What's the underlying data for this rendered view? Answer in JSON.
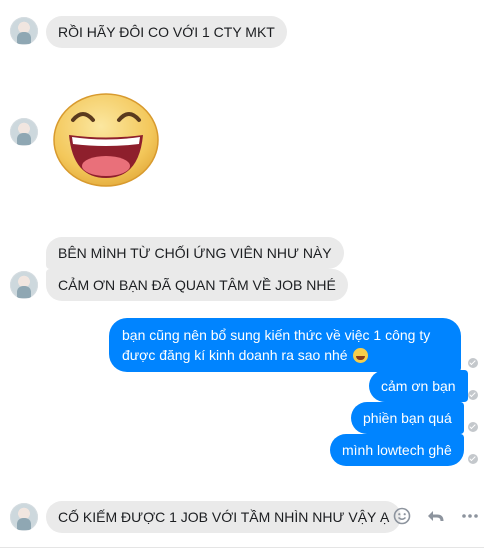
{
  "conversation": {
    "messages": [
      {
        "side": "incoming",
        "text": "RỒI HÃY ĐÔI CO VỚI 1 CTY MKT"
      },
      {
        "side": "incoming",
        "kind": "emoji-sticker",
        "icon": "laughing-face-icon"
      },
      {
        "side": "incoming",
        "text": "BÊN MÌNH TỪ CHỐI ỨNG VIÊN NHƯ NÀY"
      },
      {
        "side": "incoming",
        "text": "CẢM ƠN BẠN ĐÃ QUAN TÂM VỀ JOB NHÉ"
      },
      {
        "side": "outgoing",
        "text": "bạn cũng nên bổ sung kiến thức về việc 1 công ty được đăng kí kinh doanh ra sao nhé",
        "icon": "grinning-face-icon"
      },
      {
        "side": "outgoing",
        "text": "cảm ơn bạn"
      },
      {
        "side": "outgoing",
        "text": "phiền bạn quá"
      },
      {
        "side": "outgoing",
        "text": "mình lowtech ghê"
      },
      {
        "side": "incoming",
        "text": "CỐ KIẾM ĐƯỢC 1 JOB VỚI TẦM NHÌN NHƯ VẬY Ạ"
      }
    ]
  },
  "actions": {
    "icons": [
      "smiley-reaction-icon",
      "reply-arrow-icon",
      "more-options-icon"
    ]
  },
  "colors": {
    "outgoing_bubble": "#0084ff",
    "incoming_bubble": "#eaeaea",
    "read_tick": "#c4c8cc",
    "icon_gray": "#8d949e"
  }
}
